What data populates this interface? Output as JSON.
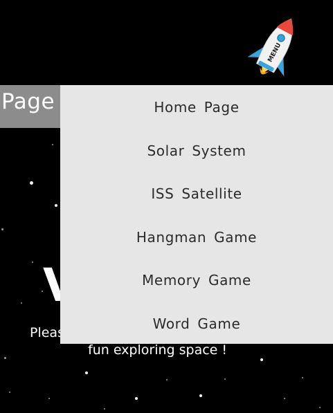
{
  "header": {
    "partial_title": "Page"
  },
  "menu_button": {
    "label": "MENU",
    "icon": "rocket-icon"
  },
  "menu": {
    "items": [
      {
        "label": "Home Page"
      },
      {
        "label": "Solar System"
      },
      {
        "label": "ISS Satellite"
      },
      {
        "label": "Hangman Game"
      },
      {
        "label": "Memory Game"
      },
      {
        "label": "Word Game"
      }
    ]
  },
  "background_content": {
    "big_letter_partial": "V",
    "subtitle_line1_partial": "Pleas",
    "subtitle_line2": "fun exploring space !"
  },
  "colors": {
    "background": "#000000",
    "menu_panel": "#e6e6e6",
    "menu_text": "#2b2b2b",
    "header_chip": "#8c8c8c",
    "rocket_body": "#f2f2f2",
    "rocket_nose": "#e8493f",
    "rocket_fins": "#3aa3d9",
    "rocket_flame": "#f5a623"
  }
}
